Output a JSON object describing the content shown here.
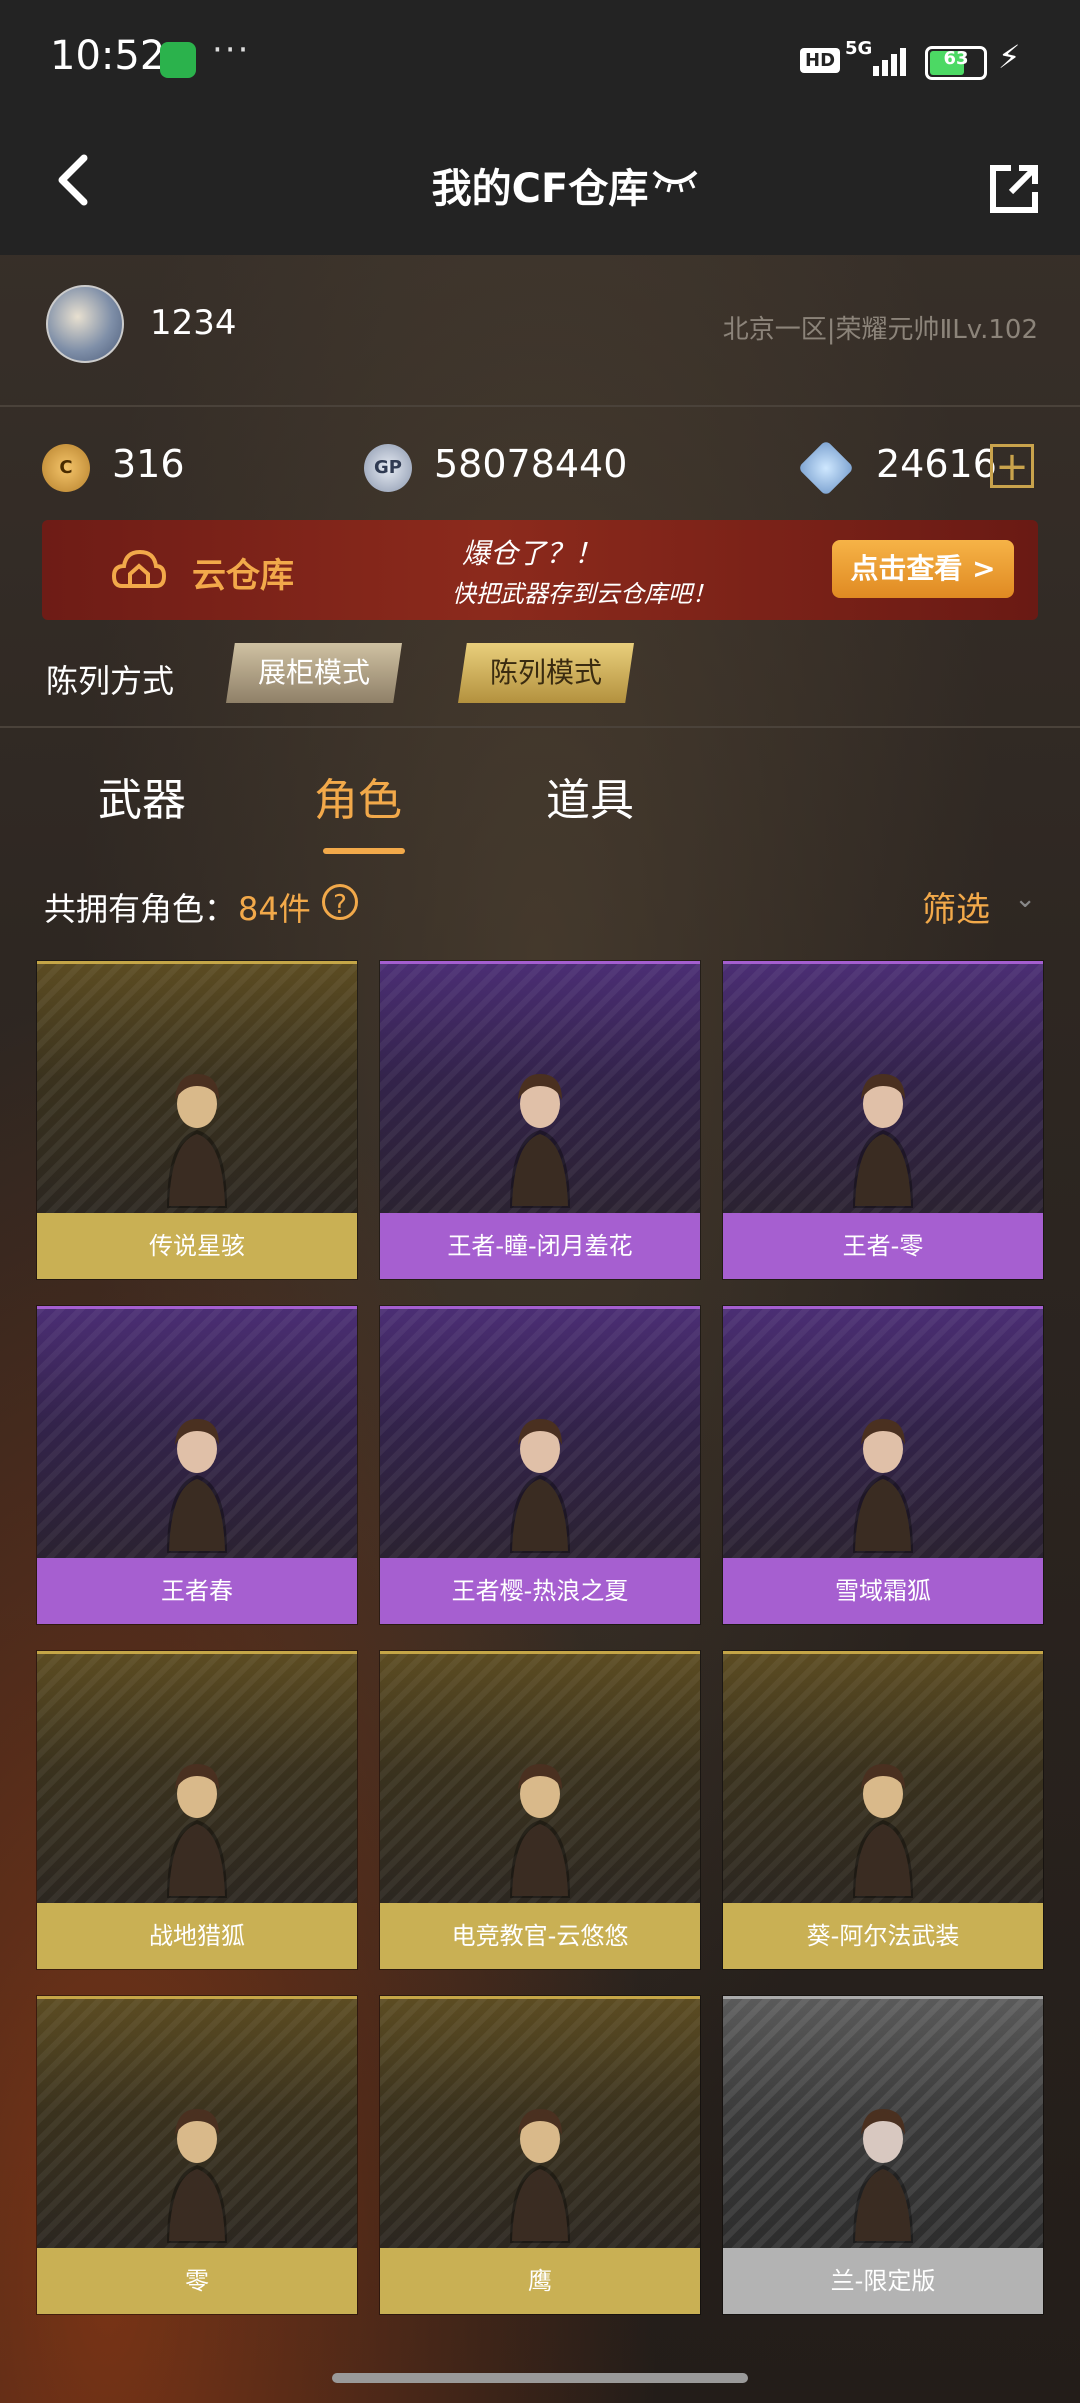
{
  "status_bar": {
    "time": "10:52",
    "dots": "···",
    "hd": "HD",
    "network": "5G",
    "battery": "63"
  },
  "nav": {
    "title": "我的CF仓库"
  },
  "profile": {
    "username": "1234",
    "rank": "北京一区|荣耀元帅ⅡLv.102"
  },
  "currency": {
    "cf": "316",
    "gp_icon": "GP",
    "gp": "58078440",
    "diamond": "24616"
  },
  "banner": {
    "name": "云仓库",
    "slogan": "爆仓了？！",
    "subtitle": "快把武器存到云仓库吧！",
    "button": "点击查看 >"
  },
  "display_mode": {
    "label": "陈列方式",
    "options": [
      "展柜模式",
      "陈列模式"
    ]
  },
  "tabs": [
    "武器",
    "角色",
    "道具"
  ],
  "active_tab": "角色",
  "count": {
    "label": "共拥有角色：",
    "value": "84件",
    "help": "?"
  },
  "filter": {
    "label": "筛选",
    "chevron": "⌄"
  },
  "characters": [
    {
      "name": "传说星骇",
      "tier": "gold"
    },
    {
      "name": "王者-瞳-闭月羞花",
      "tier": "purple"
    },
    {
      "name": "王者-零",
      "tier": "purple"
    },
    {
      "name": "王者春",
      "tier": "purple"
    },
    {
      "name": "王者樱-热浪之夏",
      "tier": "purple"
    },
    {
      "name": "雪域霜狐",
      "tier": "purple"
    },
    {
      "name": "战地猎狐",
      "tier": "gold"
    },
    {
      "name": "电竞教官-云悠悠",
      "tier": "gold"
    },
    {
      "name": "葵-阿尔法武装",
      "tier": "gold"
    },
    {
      "name": "零",
      "tier": "gold"
    },
    {
      "name": "鹰",
      "tier": "gold"
    },
    {
      "name": "兰-限定版",
      "tier": "silver"
    }
  ],
  "colors": {
    "accent": "#f2a94a",
    "gold_tier": "#c9b054",
    "purple_tier": "#a65fd0",
    "silver_tier": "#b3b3b3"
  }
}
